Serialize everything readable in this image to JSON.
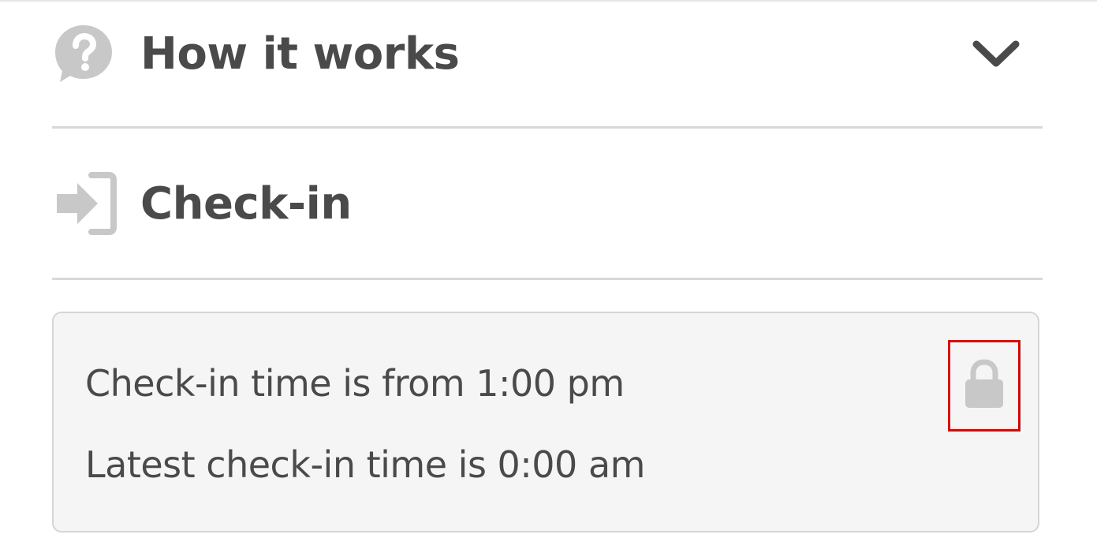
{
  "sections": {
    "how_it_works": {
      "title": "How it works",
      "icon": "question-bubble-icon",
      "toggle_icon": "chevron-down-icon"
    },
    "check_in": {
      "title": "Check-in",
      "icon": "sign-in-icon"
    }
  },
  "check_in_info": {
    "line_1": "Check-in time is from 1:00 pm",
    "line_2": "Latest check-in time is 0:00 am",
    "lock_icon": "lock-icon"
  },
  "colors": {
    "title_text": "#4a4a4a",
    "icon_gray": "#c8c8c8",
    "divider": "#d8d8d8",
    "box_bg": "#f5f5f5",
    "box_border": "#d5d5d5",
    "highlight": "#e00000"
  }
}
